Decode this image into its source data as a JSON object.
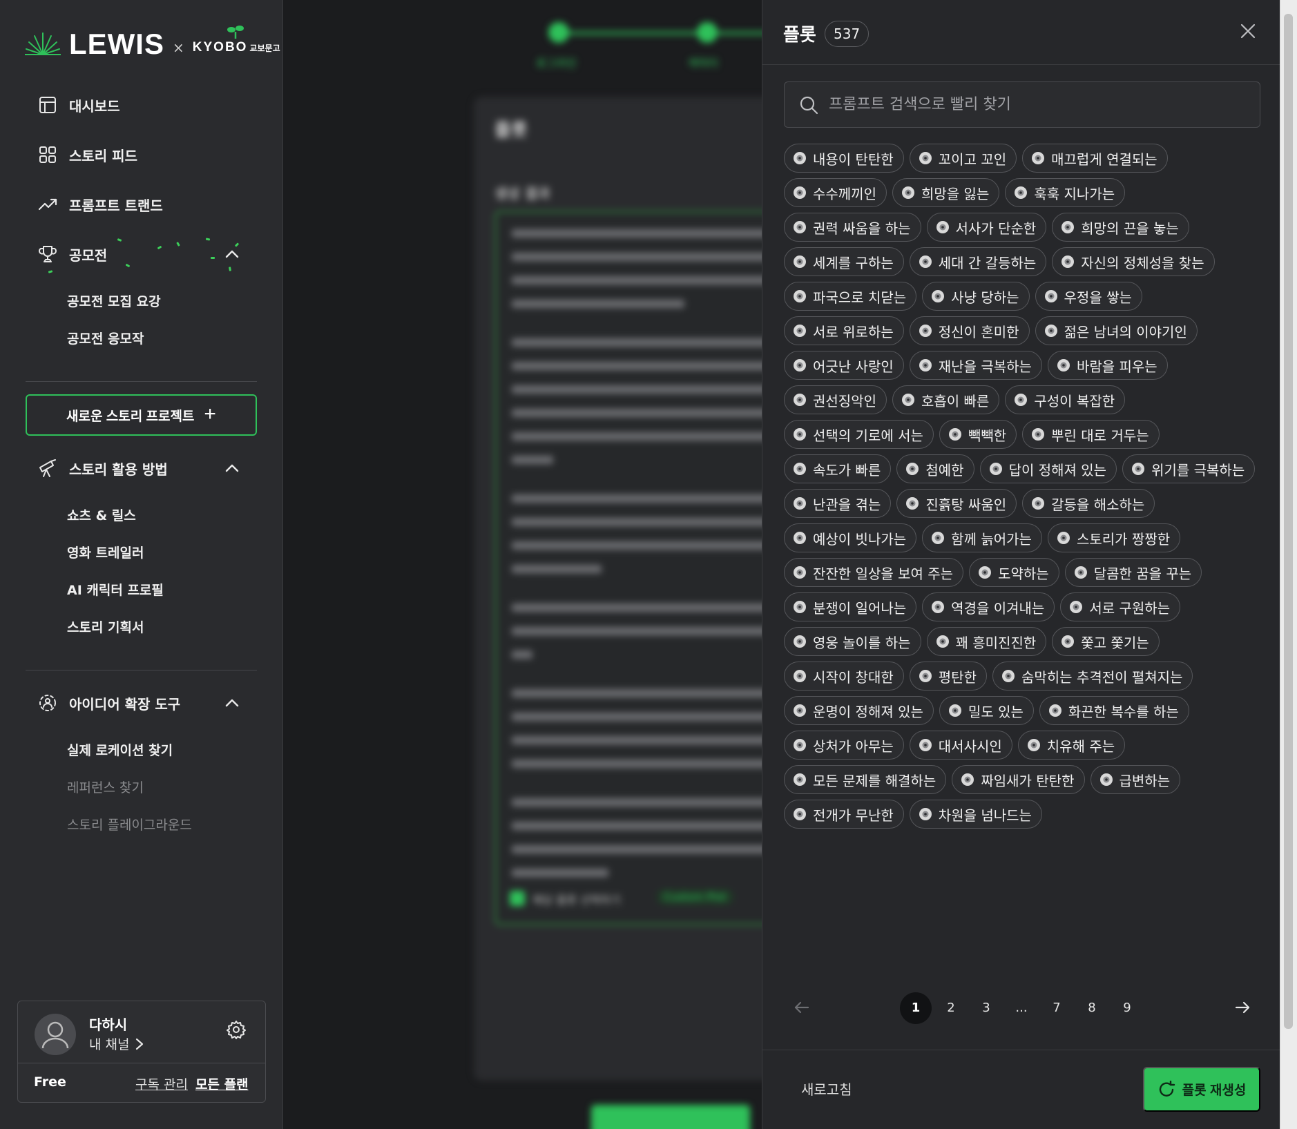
{
  "brand": {
    "name": "LEWIS",
    "x": "×",
    "partner": "KYOBO",
    "partner_sub": "교보문고"
  },
  "sidebar": {
    "nav": [
      {
        "label": "대시보드"
      },
      {
        "label": "스토리 피드"
      },
      {
        "label": "프롬프트 트랜드"
      },
      {
        "label": "공모전"
      }
    ],
    "contest_items": [
      "공모전 모집 요강",
      "공모전 응모작"
    ],
    "new_project": "새로운 스토리 프로젝트",
    "usage": {
      "label": "스토리 활용 방법",
      "items": [
        "쇼츠 & 릴스",
        "영화 트레일러",
        "AI 캐릭터 프로필",
        "스토리 기획서"
      ]
    },
    "tools": {
      "label": "아이디어 확장 도구",
      "items": [
        "실제 로케이션 찾기",
        "레퍼런스 찾기",
        "스토리 플레이그라운드"
      ]
    },
    "profile": {
      "name": "다하시",
      "channel": "내 채널",
      "plan": "Free",
      "manage": "구독 관리",
      "all_plans": "모든 플랜"
    }
  },
  "main": {
    "steps": [
      "로그라인",
      "캐릭터"
    ],
    "card_title": "플롯",
    "card_subtitle": "생성 결과",
    "selected_text": "해당 플롯 선택하기",
    "custom_tag": "Custom Plot"
  },
  "panel": {
    "title": "플롯",
    "count": "537",
    "search_placeholder": "프롬프트 검색으로 빨리 찾기",
    "chips": [
      "내용이 탄탄한",
      "꼬이고 꼬인",
      "매끄럽게 연결되는",
      "수수께끼인",
      "희망을 잃는",
      "훅훅 지나가는",
      "권력 싸움을 하는",
      "서사가 단순한",
      "희망의 끈을 놓는",
      "세계를 구하는",
      "세대 간 갈등하는",
      "자신의 정체성을 찾는",
      "파국으로 치닫는",
      "사냥 당하는",
      "우정을 쌓는",
      "서로 위로하는",
      "정신이 혼미한",
      "젊은 남녀의 이야기인",
      "어긋난 사랑인",
      "재난을 극복하는",
      "바람을 피우는",
      "권선징악인",
      "호흡이 빠른",
      "구성이 복잡한",
      "선택의 기로에 서는",
      "빽빽한",
      "뿌린 대로 거두는",
      "속도가 빠른",
      "첨예한",
      "답이 정해져 있는",
      "위기를 극복하는",
      "난관을 겪는",
      "진흙탕 싸움인",
      "갈등을 해소하는",
      "예상이 빗나가는",
      "함께 늙어가는",
      "스토리가 짱짱한",
      "잔잔한 일상을 보여 주는",
      "도약하는",
      "달콤한 꿈을 꾸는",
      "분쟁이 일어나는",
      "역경을 이겨내는",
      "서로 구원하는",
      "영웅 놀이를 하는",
      "꽤 흥미진진한",
      "쫓고 쫓기는",
      "시작이 창대한",
      "평탄한",
      "숨막히는 추격전이 펼쳐지는",
      "운명이 정해져 있는",
      "밀도 있는",
      "화끈한 복수를 하는",
      "상처가 아무는",
      "대서사시인",
      "치유해 주는",
      "모든 문제를 해결하는",
      "짜임새가 탄탄한",
      "급변하는",
      "전개가 무난한",
      "차원을 넘나드는"
    ],
    "pagination": [
      "1",
      "2",
      "3",
      "...",
      "7",
      "8",
      "9"
    ],
    "current_page": "1",
    "refresh": "새로고침",
    "regenerate": "플롯 재생성"
  },
  "colors": {
    "accent": "#2fc15a",
    "panel_bg": "#26272a",
    "sidebar_bg": "#2a2b2e"
  }
}
